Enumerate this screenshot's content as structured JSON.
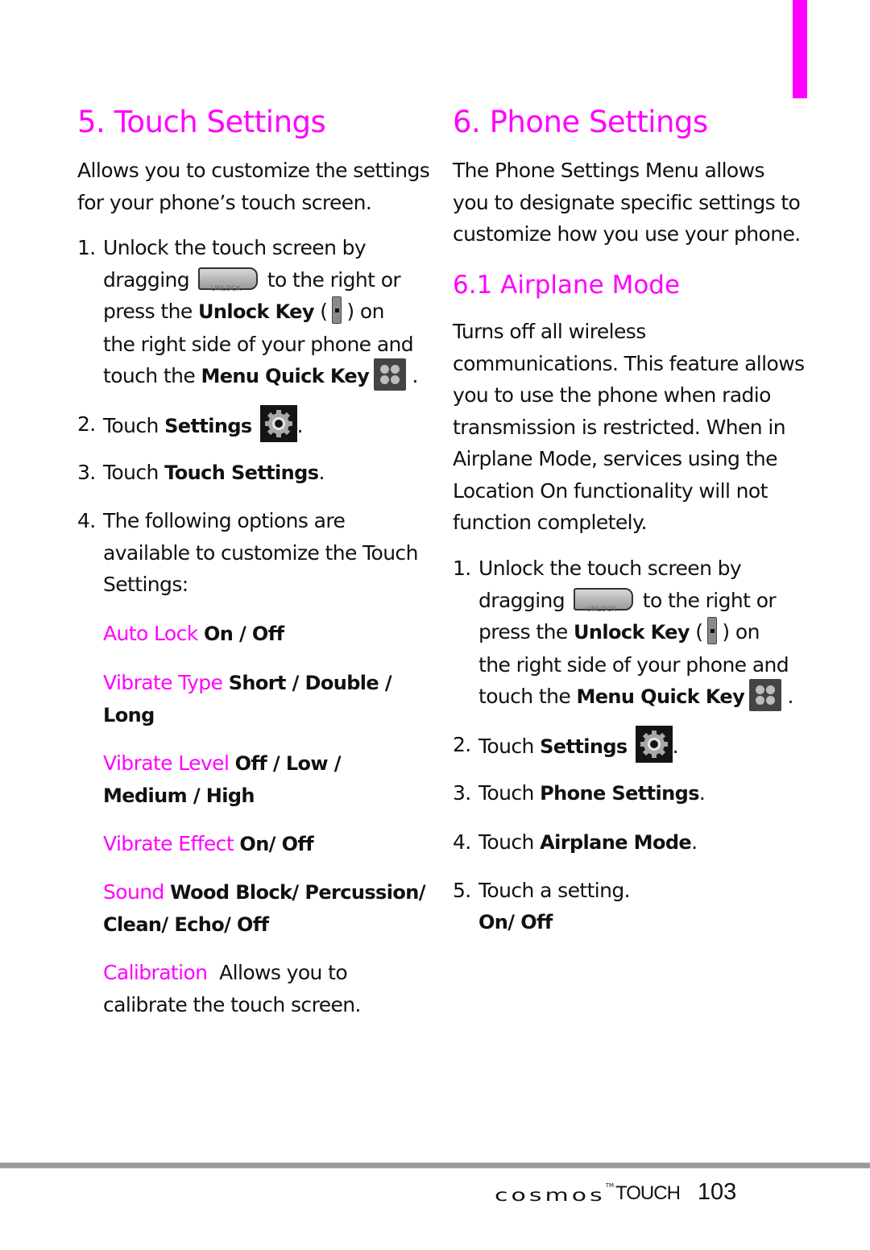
{
  "accent_color": "#ff00ff",
  "left": {
    "title": "5. Touch Settings",
    "intro": [
      "Allows you to customize the settings",
      "for your phone’s touch screen."
    ],
    "steps": [
      {
        "num": "1.",
        "lines": {
          "l1": "Unlock the touch screen by",
          "l2a": "dragging",
          "unlock_icon_text": "UNLOCK",
          "l2b": "to the right or",
          "l3a": "press the",
          "l3b": "Unlock Key",
          "l3c": "(",
          "l3d": ") on",
          "l4": "the right side of your phone and",
          "l5a": "touch the",
          "l5b": "Menu Quick Key",
          "l5c": "."
        }
      },
      {
        "num": "2.",
        "pre": "Touch",
        "bold": "Settings",
        "post": "."
      },
      {
        "num": "3.",
        "pre": "Touch",
        "bold": "Touch Settings",
        "post": "."
      },
      {
        "num": "4.",
        "lines": [
          "The following options are",
          "available to customize the Touch",
          "Settings:"
        ]
      }
    ],
    "options": [
      {
        "label": "Auto Lock",
        "values": [
          "On / Off"
        ]
      },
      {
        "label": "Vibrate Type",
        "values": [
          "Short / Double /",
          "Long"
        ]
      },
      {
        "label": "Vibrate Level",
        "values": [
          "Off / Low /",
          "Medium / High"
        ]
      },
      {
        "label": "Vibrate Effect",
        "values": [
          "On/ Off"
        ]
      },
      {
        "label": "Sound",
        "values": [
          "Wood Block/ Percussion/",
          "Clean/ Echo/ Off"
        ]
      },
      {
        "label": "Calibration",
        "values": [
          "Allows you to",
          "calibrate the touch screen."
        ]
      }
    ]
  },
  "right": {
    "title": "6. Phone Settings",
    "intro": [
      "The Phone Settings Menu allows",
      "you to designate specific settings to",
      "customize how you use your phone."
    ],
    "subtitle": "6.1 Airplane Mode",
    "sub_intro": [
      "Turns off all wireless",
      "communications. This feature allows",
      "you to use the phone when radio",
      "transmission is restricted. When in",
      "Airplane Mode, services using the",
      "Location On functionality will not",
      "function completely."
    ],
    "steps": [
      {
        "num": "1.",
        "lines": {
          "l1": "Unlock the touch screen by",
          "l2a": "dragging",
          "unlock_icon_text": "UNLOCK",
          "l2b": "to the right or",
          "l3a": "press the",
          "l3b": "Unlock Key",
          "l3c": "(",
          "l3d": ") on",
          "l4": "the right side of your phone and",
          "l5a": "touch the",
          "l5b": "Menu Quick Key",
          "l5c": "."
        }
      },
      {
        "num": "2.",
        "pre": "Touch",
        "bold": "Settings",
        "post": "."
      },
      {
        "num": "3.",
        "pre": "Touch",
        "bold": "Phone Settings",
        "post": "."
      },
      {
        "num": "4.",
        "pre": "Touch",
        "bold": "Airplane Mode",
        "post": "."
      },
      {
        "num": "5.",
        "text": "Touch a setting.",
        "value": "On/ Off"
      }
    ]
  },
  "footer": {
    "brand": "cosmos",
    "trademark": "TM",
    "brand_sub": "TOUCH",
    "page_number": "103"
  }
}
